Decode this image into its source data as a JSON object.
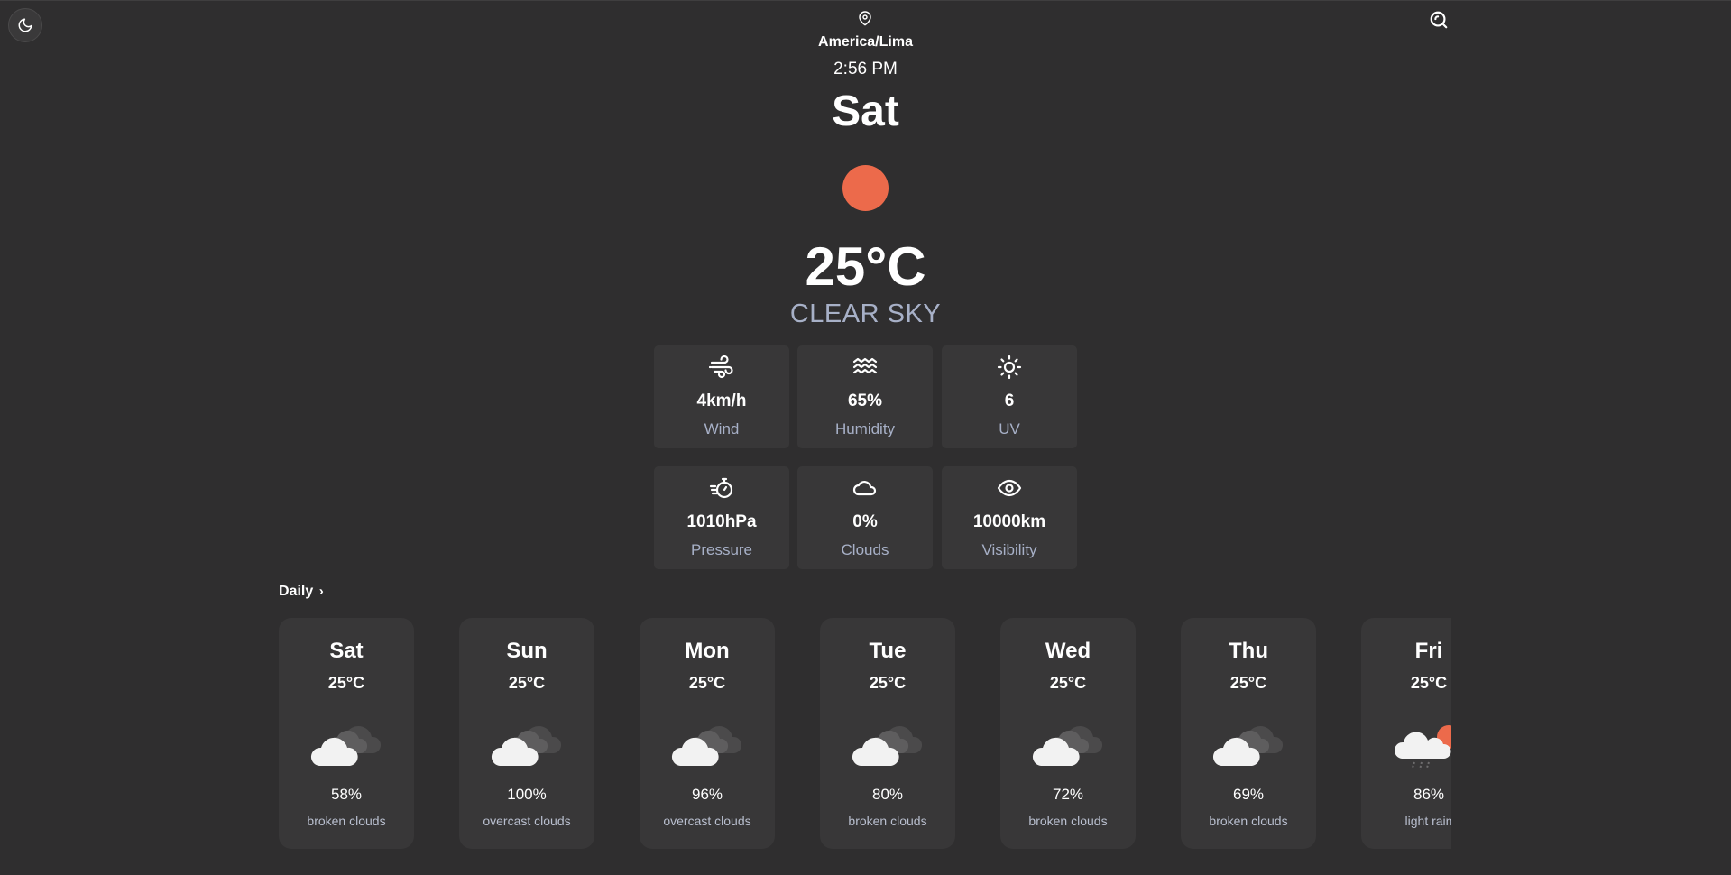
{
  "header": {
    "location": "America/Lima",
    "time": "2:56 PM",
    "day": "Sat",
    "temperature": "25°C",
    "condition": "CLEAR SKY",
    "icons": {
      "theme_toggle": "moon-icon",
      "search": "search-icon",
      "location": "map-pin-icon"
    },
    "sun_color": "#ec6a4b"
  },
  "stats": [
    {
      "value": "4km/h",
      "label": "Wind",
      "icon": "wind-icon"
    },
    {
      "value": "65%",
      "label": "Humidity",
      "icon": "waves-icon"
    },
    {
      "value": "6",
      "label": "UV",
      "icon": "sun-icon"
    },
    {
      "value": "1010hPa",
      "label": "Pressure",
      "icon": "stopwatch-icon"
    },
    {
      "value": "0%",
      "label": "Clouds",
      "icon": "cloud-icon"
    },
    {
      "value": "10000km",
      "label": "Visibility",
      "icon": "eye-icon"
    }
  ],
  "daily": {
    "heading": "Daily",
    "days": [
      {
        "day": "Sat",
        "temp": "25°C",
        "percent": "58%",
        "desc": "broken clouds",
        "icon": "clouds-icon"
      },
      {
        "day": "Sun",
        "temp": "25°C",
        "percent": "100%",
        "desc": "overcast clouds",
        "icon": "clouds-icon"
      },
      {
        "day": "Mon",
        "temp": "25°C",
        "percent": "96%",
        "desc": "overcast clouds",
        "icon": "clouds-icon"
      },
      {
        "day": "Tue",
        "temp": "25°C",
        "percent": "80%",
        "desc": "broken clouds",
        "icon": "clouds-icon"
      },
      {
        "day": "Wed",
        "temp": "25°C",
        "percent": "72%",
        "desc": "broken clouds",
        "icon": "clouds-icon"
      },
      {
        "day": "Thu",
        "temp": "25°C",
        "percent": "69%",
        "desc": "broken clouds",
        "icon": "clouds-icon"
      },
      {
        "day": "Fri",
        "temp": "25°C",
        "percent": "86%",
        "desc": "light rain",
        "icon": "sun-rain-cloud-icon"
      }
    ]
  }
}
